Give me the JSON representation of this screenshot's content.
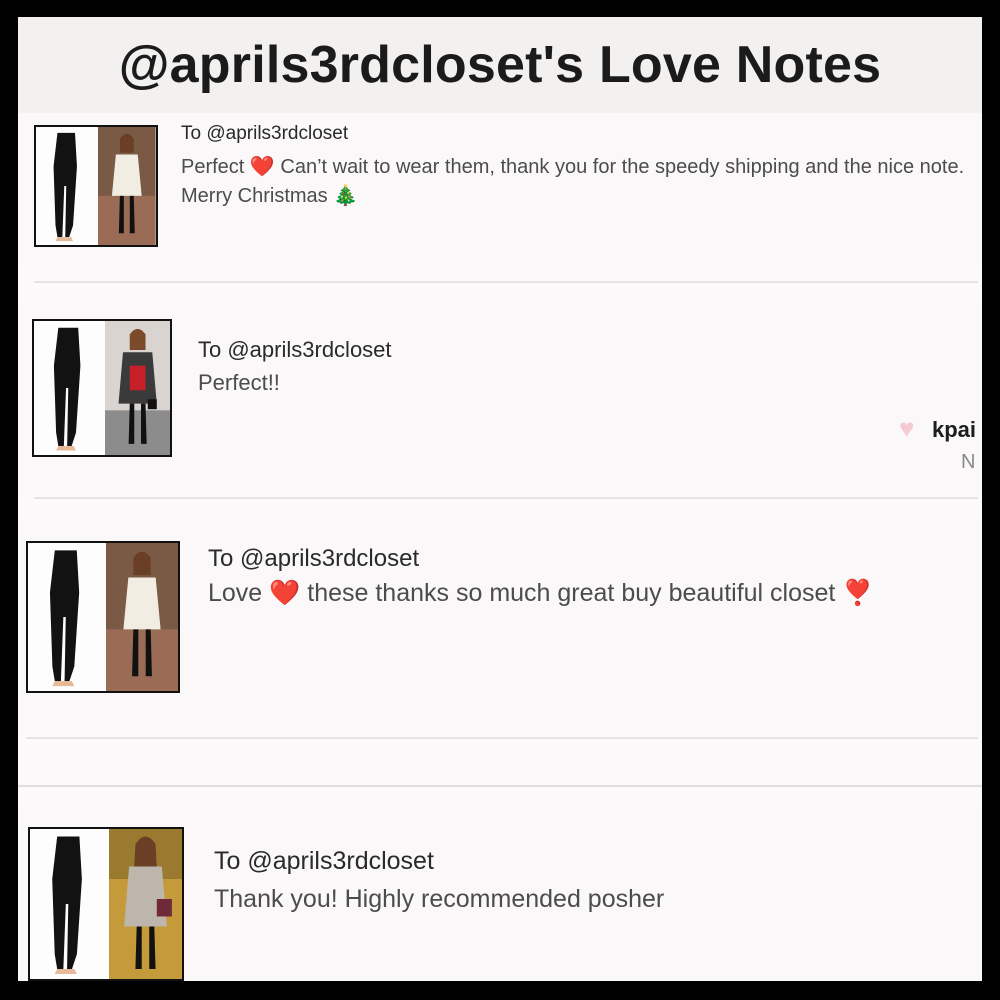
{
  "page": {
    "title": "@aprils3rdcloset's Love Notes"
  },
  "notes": [
    {
      "to": "To @aprils3rdcloset",
      "message_before": "Perfect ",
      "emoji_1": "❤️",
      "message_after": " Can’t wait to wear them, thank you for the speedy shipping and the nice note. Merry Christmas ",
      "emoji_2": "🎄"
    },
    {
      "to": "To @aprils3rdcloset",
      "message": "Perfect!!",
      "sender_heart": "♥",
      "sender": "kpai",
      "sender_sub": "N"
    },
    {
      "to": "To @aprils3rdcloset",
      "message_before": "Love ",
      "emoji_1": "❤️",
      "message_after": " these thanks so much great buy beautiful closet ",
      "emoji_2": "❣️"
    },
    {
      "to": "To @aprils3rdcloset",
      "message": "Thank you! Highly recommended posher"
    }
  ],
  "colors": {
    "frame": "#000000",
    "header_bg": "#f2f1ef",
    "card_bg": "#faf8f9",
    "heart_red": "#e12427",
    "heart_pink": "#f5c9d2"
  }
}
